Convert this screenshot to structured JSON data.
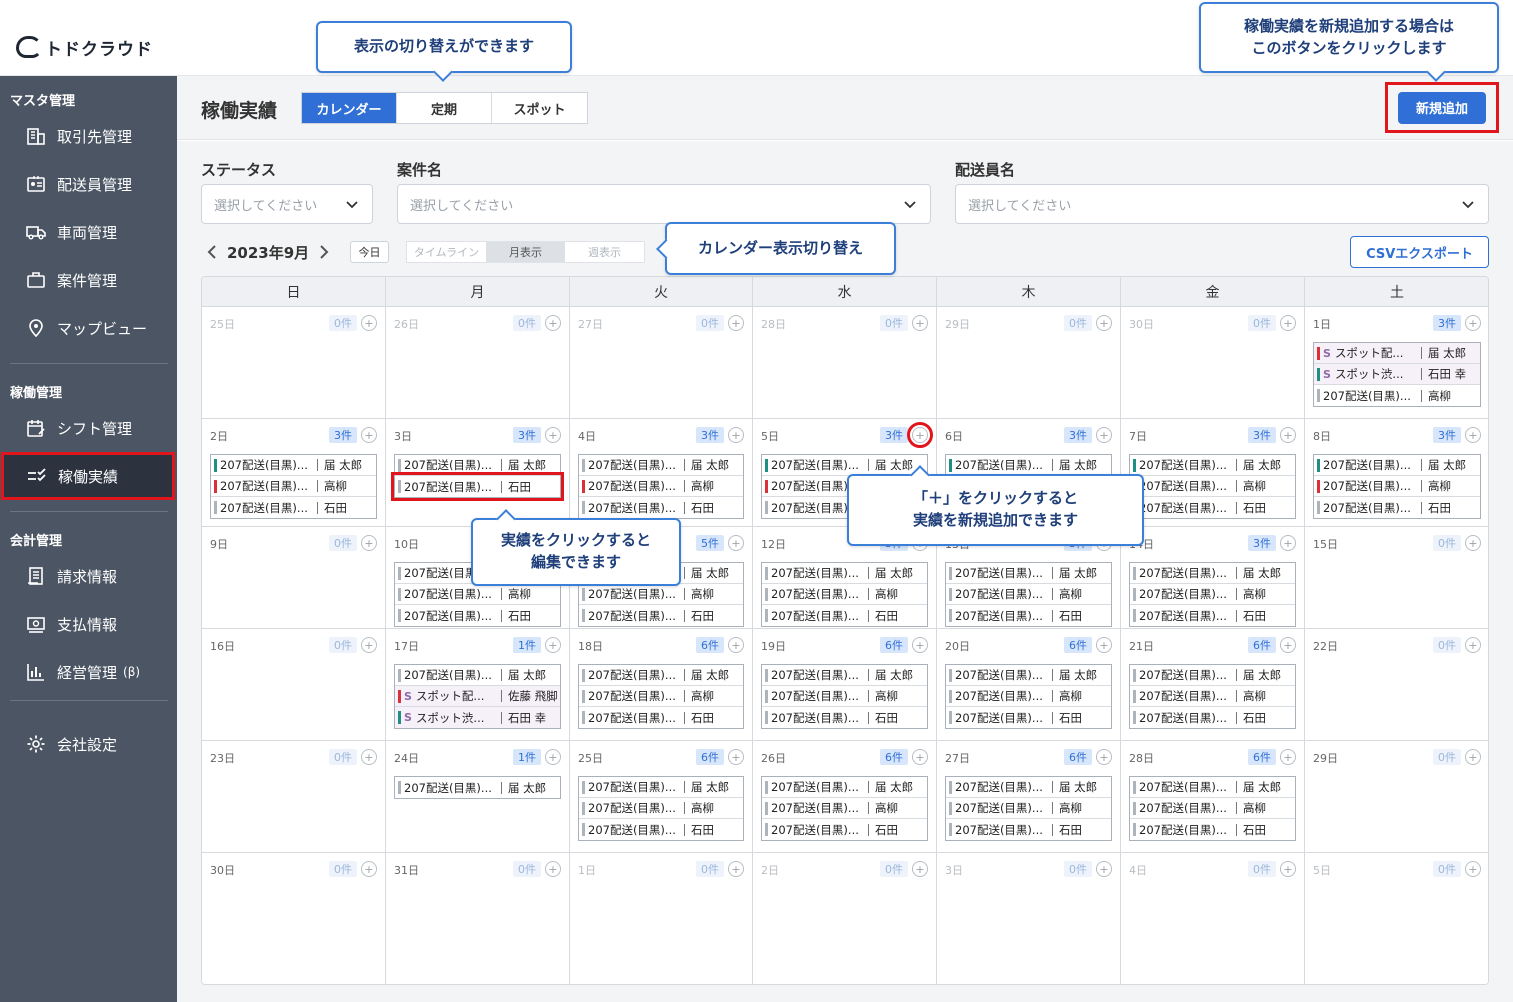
{
  "app": {
    "logo_text": "トドクラウド"
  },
  "sidebar": {
    "sections": [
      {
        "label": "マスタ管理",
        "items": [
          {
            "label": "取引先管理",
            "icon": "building-icon"
          },
          {
            "label": "配送員管理",
            "icon": "id-badge-icon"
          },
          {
            "label": "車両管理",
            "icon": "truck-icon"
          },
          {
            "label": "案件管理",
            "icon": "briefcase-icon"
          },
          {
            "label": "マップビュー",
            "icon": "map-pin-icon"
          }
        ]
      },
      {
        "label": "稼働管理",
        "items": [
          {
            "label": "シフト管理",
            "icon": "calendar-edit-icon"
          },
          {
            "label": "稼働実績",
            "icon": "checklist-icon",
            "active": true
          }
        ]
      },
      {
        "label": "会計管理",
        "items": [
          {
            "label": "請求情報",
            "icon": "invoice-icon"
          },
          {
            "label": "支払情報",
            "icon": "payment-icon"
          },
          {
            "label": "経営管理",
            "badge": "(β)",
            "icon": "bar-chart-icon"
          }
        ]
      }
    ],
    "settings": {
      "label": "会社設定",
      "icon": "gear-icon"
    }
  },
  "header": {
    "title": "稼働実績",
    "tabs": [
      {
        "label": "カレンダー",
        "active": true
      },
      {
        "label": "定期"
      },
      {
        "label": "スポット"
      }
    ],
    "add_button": "新規追加"
  },
  "filters": {
    "status": {
      "label": "ステータス",
      "placeholder": "選択してください"
    },
    "case": {
      "label": "案件名",
      "placeholder": "選択してください"
    },
    "driver": {
      "label": "配送員名",
      "placeholder": "選択してください"
    }
  },
  "toolbar": {
    "month": "2023年9月",
    "today": "今日",
    "ranges": [
      {
        "label": "タイムライン"
      },
      {
        "label": "月表示",
        "active": true
      },
      {
        "label": "週表示"
      }
    ],
    "csv_button": "CSVエクスポート"
  },
  "calendar": {
    "weekdays": [
      "日",
      "月",
      "火",
      "水",
      "木",
      "金",
      "土"
    ],
    "weeks": [
      [
        {
          "day": "25日",
          "count": "0件",
          "other": true,
          "events": []
        },
        {
          "day": "26日",
          "count": "0件",
          "other": true,
          "events": []
        },
        {
          "day": "27日",
          "count": "0件",
          "other": true,
          "events": []
        },
        {
          "day": "28日",
          "count": "0件",
          "other": true,
          "events": []
        },
        {
          "day": "29日",
          "count": "0件",
          "other": true,
          "events": []
        },
        {
          "day": "30日",
          "count": "0件",
          "other": true,
          "events": []
        },
        {
          "day": "1日",
          "count": "3件",
          "events": [
            {
              "name": "スポット配...",
              "who": "届 太郎",
              "color": "red",
              "spot": true
            },
            {
              "name": "スポット渋...",
              "who": "石田 幸",
              "color": "teal",
              "spot": true
            },
            {
              "name": "207配送(目黒)...",
              "who": "高柳"
            }
          ]
        }
      ],
      [
        {
          "day": "2日",
          "count": "3件",
          "events": [
            {
              "name": "207配送(目黒)...",
              "who": "届 太郎",
              "color": "teal"
            },
            {
              "name": "207配送(目黒)...",
              "who": "高柳",
              "color": "red"
            },
            {
              "name": "207配送(目黒)...",
              "who": "石田"
            }
          ]
        },
        {
          "day": "3日",
          "count": "3件",
          "events": [
            {
              "name": "207配送(目黒)...",
              "who": "届 太郎"
            },
            {
              "name": "207配送(目黒)...",
              "who": "石田",
              "highlight": true
            }
          ]
        },
        {
          "day": "4日",
          "count": "3件",
          "events": [
            {
              "name": "207配送(目黒)...",
              "who": "届 太郎"
            },
            {
              "name": "207配送(目黒)...",
              "who": "高柳",
              "color": "red"
            },
            {
              "name": "207配送(目黒)...",
              "who": "石田"
            }
          ]
        },
        {
          "day": "5日",
          "count": "3件",
          "plus_highlight": true,
          "events": [
            {
              "name": "207配送(目黒)...",
              "who": "届 太郎",
              "color": "teal"
            },
            {
              "name": "207配送(目黒)...",
              "who": "高柳",
              "color": "red"
            },
            {
              "name": "207配送(目黒)...",
              "who": "石田"
            }
          ]
        },
        {
          "day": "6日",
          "count": "3件",
          "events": [
            {
              "name": "207配送(目黒)...",
              "who": "届 太郎",
              "color": "teal"
            },
            {
              "name": "207配送(目黒)...",
              "who": "高柳"
            },
            {
              "name": "207配送(目黒)...",
              "who": "石田"
            }
          ]
        },
        {
          "day": "7日",
          "count": "3件",
          "events": [
            {
              "name": "207配送(目黒)...",
              "who": "届 太郎",
              "color": "teal"
            },
            {
              "name": "207配送(目黒)...",
              "who": "高柳"
            },
            {
              "name": "207配送(目黒)...",
              "who": "石田"
            }
          ]
        },
        {
          "day": "8日",
          "count": "3件",
          "events": [
            {
              "name": "207配送(目黒)...",
              "who": "届 太郎",
              "color": "teal"
            },
            {
              "name": "207配送(目黒)...",
              "who": "高柳",
              "color": "red"
            },
            {
              "name": "207配送(目黒)...",
              "who": "石田"
            }
          ]
        }
      ],
      [
        {
          "day": "9日",
          "count": "0件",
          "events": []
        },
        {
          "day": "10日",
          "count": "3件",
          "events": [
            {
              "name": "207配送(目黒)...",
              "who": "届 太郎"
            },
            {
              "name": "207配送(目黒)...",
              "who": "高柳"
            },
            {
              "name": "207配送(目黒)...",
              "who": "石田"
            }
          ]
        },
        {
          "day": "11日",
          "count": "5件",
          "events": [
            {
              "name": "207配送(目黒)...",
              "who": "届 太郎"
            },
            {
              "name": "207配送(目黒)...",
              "who": "高柳"
            },
            {
              "name": "207配送(目黒)...",
              "who": "石田"
            }
          ]
        },
        {
          "day": "12日",
          "count": "3件",
          "events": [
            {
              "name": "207配送(目黒)...",
              "who": "届 太郎"
            },
            {
              "name": "207配送(目黒)...",
              "who": "高柳"
            },
            {
              "name": "207配送(目黒)...",
              "who": "石田"
            }
          ]
        },
        {
          "day": "13日",
          "count": "3件",
          "events": [
            {
              "name": "207配送(目黒)...",
              "who": "届 太郎"
            },
            {
              "name": "207配送(目黒)...",
              "who": "高柳"
            },
            {
              "name": "207配送(目黒)...",
              "who": "石田"
            }
          ]
        },
        {
          "day": "14日",
          "count": "3件",
          "events": [
            {
              "name": "207配送(目黒)...",
              "who": "届 太郎"
            },
            {
              "name": "207配送(目黒)...",
              "who": "高柳"
            },
            {
              "name": "207配送(目黒)...",
              "who": "石田"
            }
          ]
        },
        {
          "day": "15日",
          "count": "0件",
          "events": []
        }
      ],
      [
        {
          "day": "16日",
          "count": "0件",
          "events": []
        },
        {
          "day": "17日",
          "count": "1件",
          "events": [
            {
              "name": "207配送(目黒)...",
              "who": "届 太郎"
            },
            {
              "name": "スポット配...",
              "who": "佐藤 飛脚",
              "color": "red",
              "spot": true
            },
            {
              "name": "スポット渋...",
              "who": "石田 幸",
              "color": "teal",
              "spot": true
            }
          ]
        },
        {
          "day": "18日",
          "count": "6件",
          "events": [
            {
              "name": "207配送(目黒)...",
              "who": "届 太郎"
            },
            {
              "name": "207配送(目黒)...",
              "who": "高柳"
            },
            {
              "name": "207配送(目黒)...",
              "who": "石田"
            }
          ]
        },
        {
          "day": "19日",
          "count": "6件",
          "events": [
            {
              "name": "207配送(目黒)...",
              "who": "届 太郎"
            },
            {
              "name": "207配送(目黒)...",
              "who": "高柳"
            },
            {
              "name": "207配送(目黒)...",
              "who": "石田"
            }
          ]
        },
        {
          "day": "20日",
          "count": "6件",
          "events": [
            {
              "name": "207配送(目黒)...",
              "who": "届 太郎"
            },
            {
              "name": "207配送(目黒)...",
              "who": "高柳"
            },
            {
              "name": "207配送(目黒)...",
              "who": "石田"
            }
          ]
        },
        {
          "day": "21日",
          "count": "6件",
          "events": [
            {
              "name": "207配送(目黒)...",
              "who": "届 太郎"
            },
            {
              "name": "207配送(目黒)...",
              "who": "高柳"
            },
            {
              "name": "207配送(目黒)...",
              "who": "石田"
            }
          ]
        },
        {
          "day": "22日",
          "count": "0件",
          "events": []
        }
      ],
      [
        {
          "day": "23日",
          "count": "0件",
          "events": []
        },
        {
          "day": "24日",
          "count": "1件",
          "events": [
            {
              "name": "207配送(目黒)...",
              "who": "届 太郎"
            }
          ]
        },
        {
          "day": "25日",
          "count": "6件",
          "events": [
            {
              "name": "207配送(目黒)...",
              "who": "届 太郎"
            },
            {
              "name": "207配送(目黒)...",
              "who": "高柳"
            },
            {
              "name": "207配送(目黒)...",
              "who": "石田"
            }
          ]
        },
        {
          "day": "26日",
          "count": "6件",
          "events": [
            {
              "name": "207配送(目黒)...",
              "who": "届 太郎"
            },
            {
              "name": "207配送(目黒)...",
              "who": "高柳"
            },
            {
              "name": "207配送(目黒)...",
              "who": "石田"
            }
          ]
        },
        {
          "day": "27日",
          "count": "6件",
          "events": [
            {
              "name": "207配送(目黒)...",
              "who": "届 太郎"
            },
            {
              "name": "207配送(目黒)...",
              "who": "高柳"
            },
            {
              "name": "207配送(目黒)...",
              "who": "石田"
            }
          ]
        },
        {
          "day": "28日",
          "count": "6件",
          "events": [
            {
              "name": "207配送(目黒)...",
              "who": "届 太郎"
            },
            {
              "name": "207配送(目黒)...",
              "who": "高柳"
            },
            {
              "name": "207配送(目黒)...",
              "who": "石田"
            }
          ]
        },
        {
          "day": "29日",
          "count": "0件",
          "events": []
        }
      ],
      [
        {
          "day": "30日",
          "count": "0件",
          "events": []
        },
        {
          "day": "31日",
          "count": "0件",
          "events": []
        },
        {
          "day": "1日",
          "count": "0件",
          "other": true,
          "events": []
        },
        {
          "day": "2日",
          "count": "0件",
          "other": true,
          "events": []
        },
        {
          "day": "3日",
          "count": "0件",
          "other": true,
          "events": []
        },
        {
          "day": "4日",
          "count": "0件",
          "other": true,
          "events": []
        },
        {
          "day": "5日",
          "count": "0件",
          "other": true,
          "events": []
        }
      ]
    ]
  },
  "callouts": {
    "view_switch": "表示の切り替えができます",
    "add_new": "稼働実績を新規追加する場合は\nこのボタンをクリックします",
    "calendar_switch": "カレンダー表示切り替え",
    "edit": "実績をクリックすると\n編集できます",
    "plus": "「＋」をクリックすると\n実績を新規追加できます"
  },
  "colors": {
    "primary": "#2f6fd6",
    "sidebar": "#4b5563",
    "highlight": "#e0161c",
    "teal": "#1f8f84",
    "red": "#d9303a"
  }
}
